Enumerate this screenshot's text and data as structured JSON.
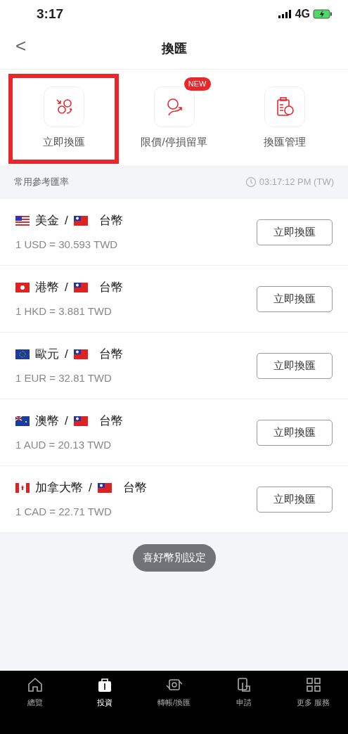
{
  "status_bar": {
    "time": "3:17",
    "network": "4G"
  },
  "header": {
    "back": "<",
    "title": "換匯"
  },
  "actions": [
    {
      "kind": "exchange",
      "label": "立即換匯",
      "highlighted": true
    },
    {
      "kind": "limit",
      "label": "限價/停損留單",
      "badge": "NEW",
      "highlighted": false
    },
    {
      "kind": "manage",
      "label": "換匯管理",
      "highlighted": false
    }
  ],
  "rates_header": {
    "title": "常用參考匯率",
    "time": "03:17:12 PM (TW)"
  },
  "rates": [
    {
      "from": {
        "kind": "us",
        "label": "美金"
      },
      "separator": "/",
      "to": {
        "kind": "tw",
        "label": "台幣"
      },
      "rate": "1 USD = 30.593 TWD",
      "button": "立即換匯"
    },
    {
      "from": {
        "kind": "hk",
        "label": "港幣"
      },
      "separator": "/",
      "to": {
        "kind": "tw",
        "label": "台幣"
      },
      "rate": "1 HKD = 3.881 TWD",
      "button": "立即換匯"
    },
    {
      "from": {
        "kind": "eu",
        "label": "歐元"
      },
      "separator": "/",
      "to": {
        "kind": "tw",
        "label": "台幣"
      },
      "rate": "1 EUR = 32.81 TWD",
      "button": "立即換匯"
    },
    {
      "from": {
        "kind": "au",
        "label": "澳幣"
      },
      "separator": "/",
      "to": {
        "kind": "tw",
        "label": "台幣"
      },
      "rate": "1 AUD = 20.13 TWD",
      "button": "立即換匯"
    },
    {
      "from": {
        "kind": "ca",
        "label": "加拿大幣"
      },
      "separator": "/",
      "to": {
        "kind": "tw",
        "label": "台幣"
      },
      "rate": "1 CAD = 22.71 TWD",
      "button": "立即換匯"
    }
  ],
  "settings_button": "喜好幣別設定",
  "tab_bar": [
    {
      "kind": "home",
      "label": "總覽",
      "selected": false
    },
    {
      "kind": "invest",
      "label": "投資",
      "selected": true
    },
    {
      "kind": "transfer",
      "label": "轉帳/換匯",
      "selected": false
    },
    {
      "kind": "apply",
      "label": "申請",
      "selected": false
    },
    {
      "kind": "more",
      "label": "更多 服務",
      "selected": false
    }
  ]
}
